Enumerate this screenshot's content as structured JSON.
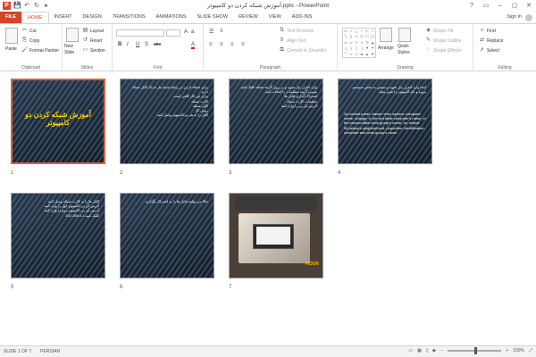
{
  "window": {
    "title": "آموزش شبکه کردن دو کامپیوتر.pptx - PowerPoint",
    "controls": [
      "?",
      "▭",
      "–",
      "▢",
      "✕"
    ]
  },
  "quick_access": [
    "💾",
    "↶",
    "↻",
    "▸"
  ],
  "app_icon_letter": "P",
  "tabs": {
    "file": "FILE",
    "items": [
      "HOME",
      "INSERT",
      "DESIGN",
      "TRANSITIONS",
      "ANIMATIONS",
      "SLIDE SHOW",
      "REVIEW",
      "VIEW",
      "ADD-INS"
    ],
    "active": "HOME"
  },
  "account": {
    "sign_in": "Sign in"
  },
  "ribbon": {
    "clipboard": {
      "label": "Clipboard",
      "paste": "Paste",
      "cut": "Cut",
      "copy": "Copy",
      "format_painter": "Format Painter"
    },
    "slides": {
      "label": "Slides",
      "new_slide": "New",
      "new_slide2": "Slide",
      "layout": "Layout",
      "reset": "Reset",
      "section": "Section"
    },
    "font": {
      "label": "Font",
      "bold": "B",
      "italic": "I",
      "underline": "U",
      "shadow": "S",
      "strike": "abc",
      "font_color": "A"
    },
    "paragraph": {
      "label": "Paragraph",
      "text_direction": "Text Direction",
      "align_text": "Align Text",
      "convert_smartart": "Convert to SmartArt"
    },
    "drawing": {
      "label": "Drawing",
      "arrange": "Arrange",
      "quick_styles": "Quick",
      "quick_styles2": "Styles",
      "shape_fill": "Shape Fill",
      "shape_outline": "Shape Outline",
      "shape_effects": "Shape Effects"
    },
    "editing": {
      "label": "Editing",
      "find": "Find",
      "replace": "Replace",
      "select": "Select"
    }
  },
  "slides": [
    {
      "num": "1",
      "title": "آموزش شبکه کردن دو کامپیوتر",
      "text": "",
      "selected": true
    },
    {
      "num": "2",
      "text": "برای شبکه کردن در رایانه شما نیاز به یک کابل شبکه دارید\nبرای این کار کافی است\nکارت شبکه\nکابل شبکه\nروش کار\nکابل را به هر دو کامپیوتر وصل کنید",
      "selected": false
    },
    {
      "num": "3",
      "text": "وارد کنترل پنل شوید و بر روی گزینه شبکه کلیک کنید\nسپس گزینه تنظیمات را انتخاب کنید\nاشتراک گذاری فایل ها\nتنظیمات کارت شبکه\nآدرس آی پی را وارد کنید",
      "selected": false
    },
    {
      "num": "4",
      "text": "ابتدا وارد کنترل پنل شوید و سپس به بخش سیستم بروید و نام کامپیوتر را تغییر دهید",
      "text_en": "Xp control panel, classic view, system, computer name, change, in the text table computer's name, in the second table work group's name, ok, restart.\n98,network neighborhood, properties, identification, computer and work group's name.",
      "selected": false
    },
    {
      "num": "5",
      "text": "کابل ها را به کارت شبکه وصل کنید\nآدرس آی پی کامپیوتر اول را وارد کنید\nآدرس آی پی کامپیوتر دوم را وارد کنید\nکلیک کنید 192.168.0.1",
      "selected": false
    },
    {
      "num": "6",
      "text": "حالا می توانید فایل ها را به اشتراک بگذارید",
      "selected": false
    },
    {
      "num": "7",
      "text": "",
      "logo": "PIDUR",
      "selected": false
    }
  ],
  "status": {
    "slide_of": "SLIDE 1 OF 7",
    "language": "PERSIAN",
    "zoom": "100%",
    "zoom_fraction": 0.5
  }
}
